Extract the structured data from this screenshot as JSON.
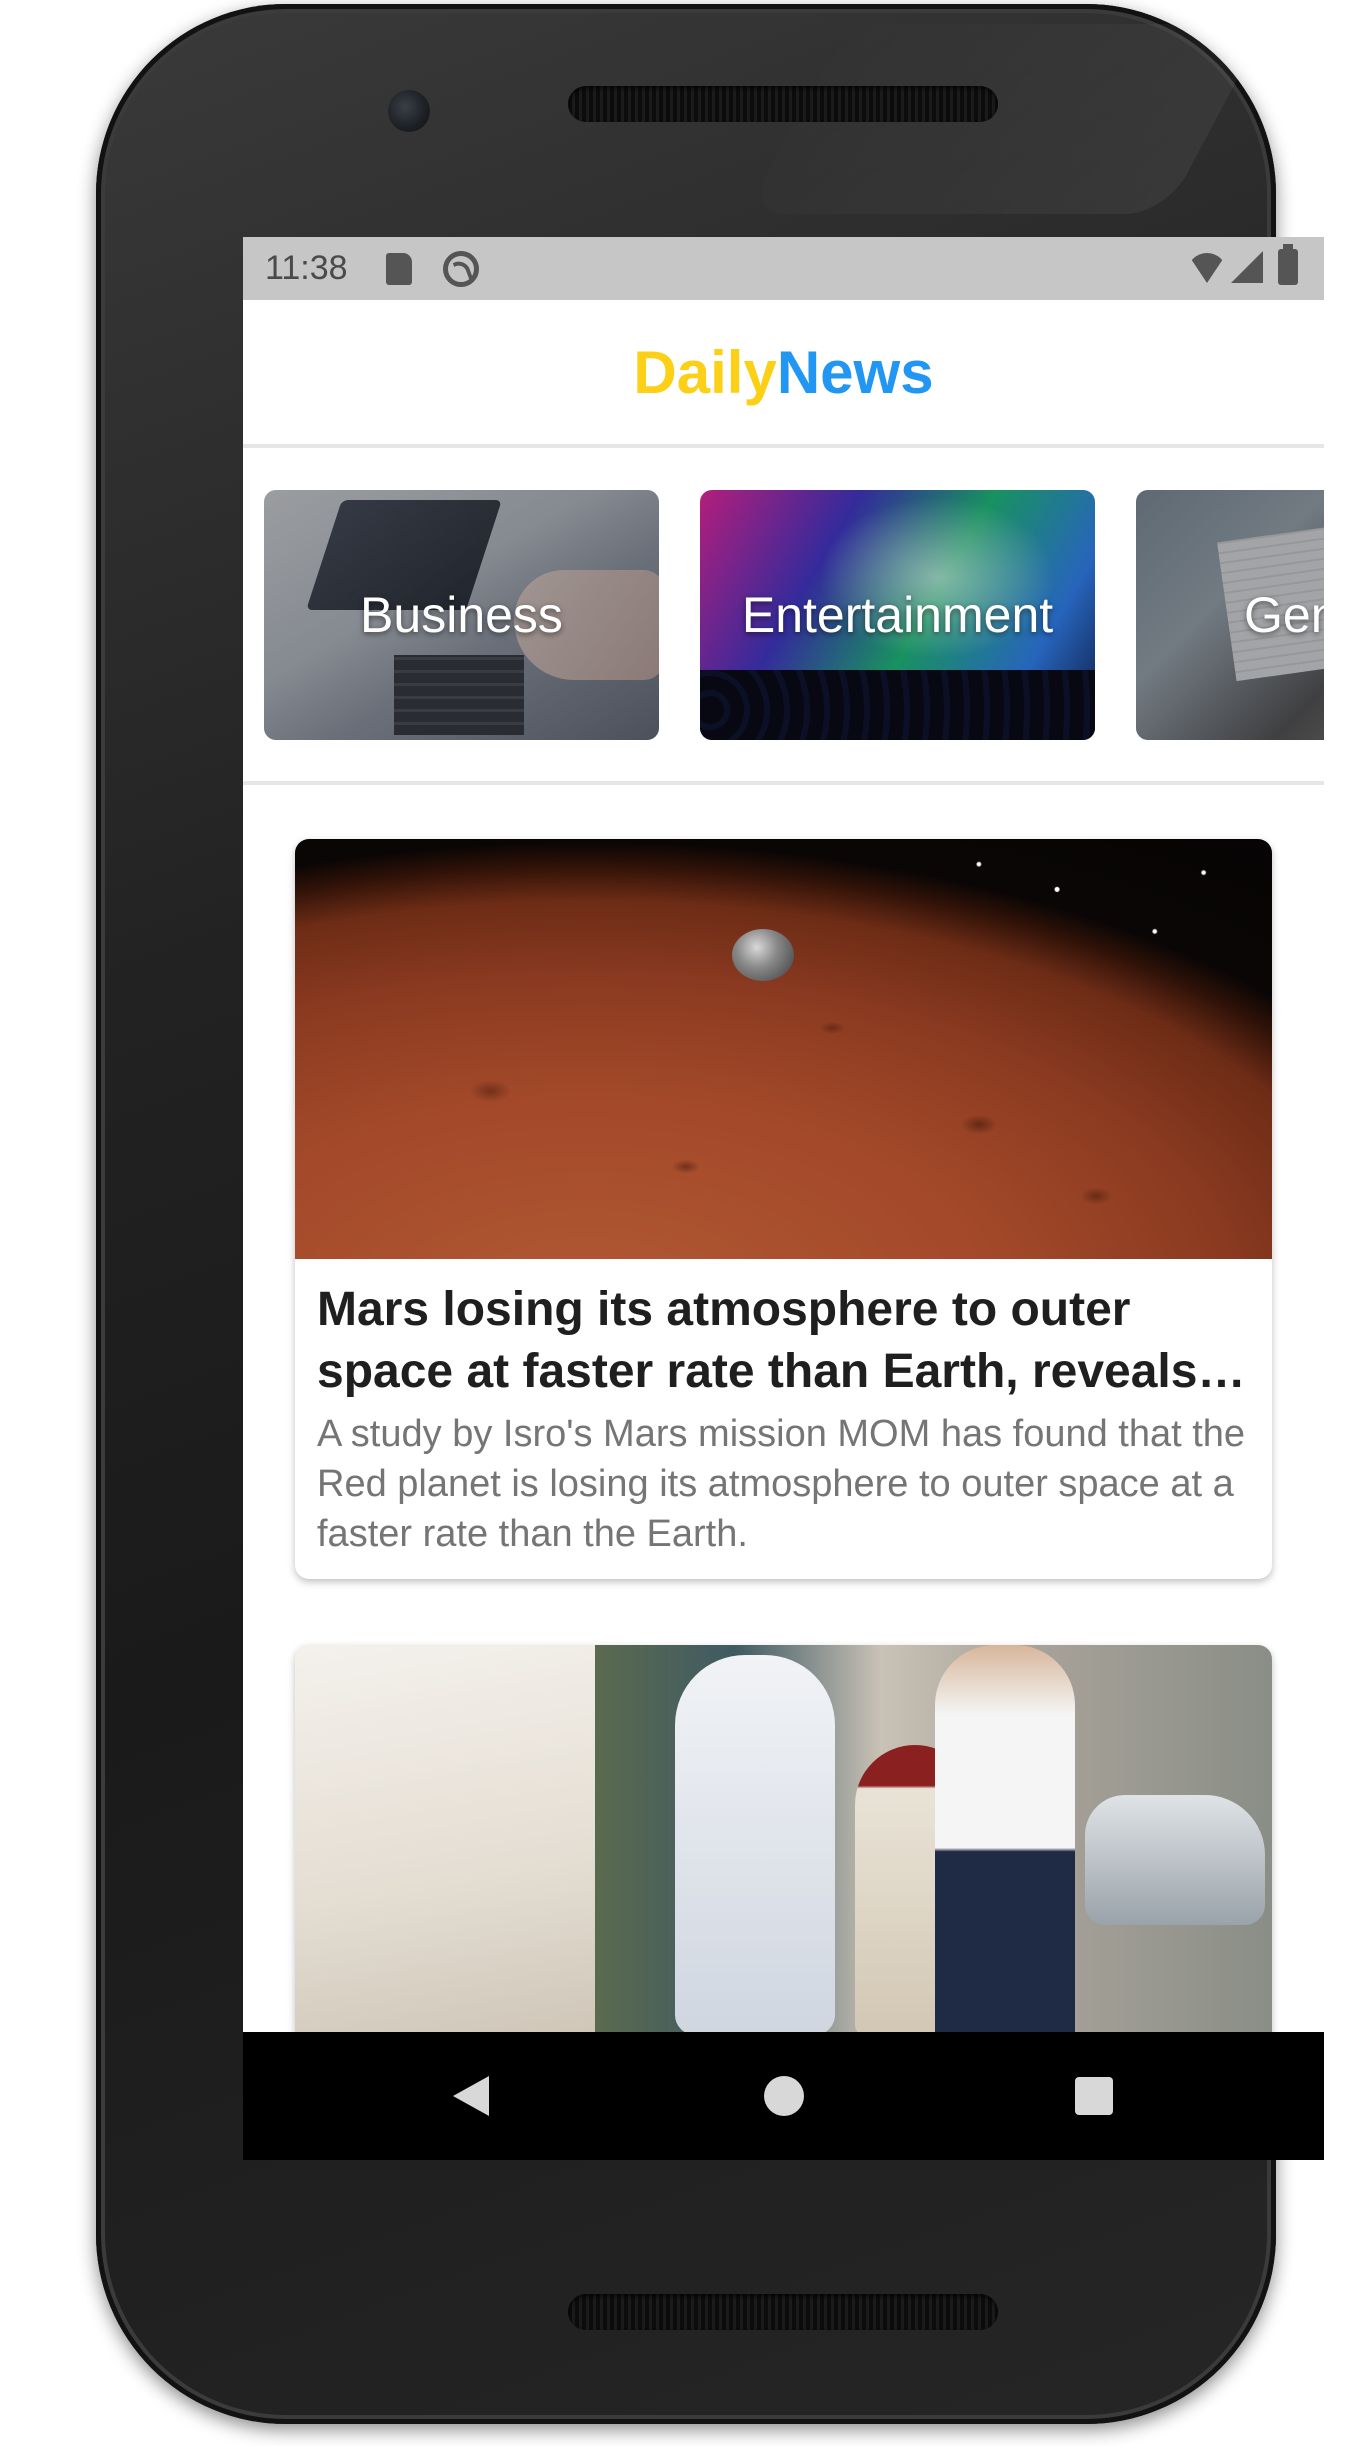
{
  "status_bar": {
    "time": "11:38",
    "icons": [
      "sd-card-icon",
      "do-not-disturb-icon",
      "wifi-icon",
      "signal-icon",
      "battery-icon"
    ]
  },
  "header": {
    "brand_part1": "Daily",
    "brand_part2": "News",
    "brand_color_1": "#fbd016",
    "brand_color_2": "#2196f3"
  },
  "categories": [
    {
      "label": "Business"
    },
    {
      "label": "Entertainment"
    },
    {
      "label": "General"
    }
  ],
  "articles": [
    {
      "title": "Mars losing its atmosphere to outer space at faster rate than Earth, reveals Isro's MOM",
      "description": "A study by Isro's Mars mission MOM has found that the Red planet is losing its atmosphere to outer space at a faster rate than the Earth."
    }
  ],
  "nav_bar": {
    "icons": [
      "back-icon",
      "home-icon",
      "recents-icon"
    ]
  }
}
